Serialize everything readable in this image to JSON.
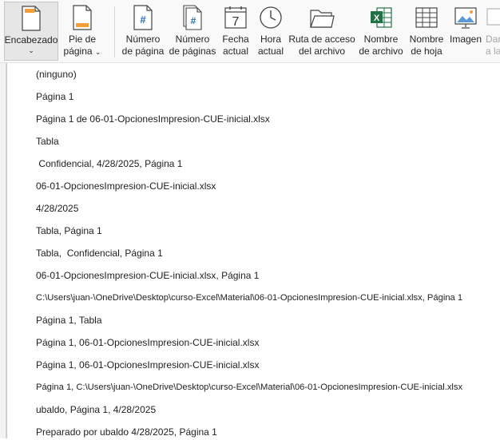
{
  "ribbon": {
    "header": {
      "line1": "Encabezado",
      "icon": "header-page-icon"
    },
    "footer": {
      "line1": "Pie de",
      "line2": "página",
      "icon": "footer-page-icon"
    },
    "page_number": {
      "line1": "Número",
      "line2": "de página",
      "icon": "page-number-icon"
    },
    "page_count": {
      "line1": "Número",
      "line2": "de páginas",
      "icon": "page-count-icon"
    },
    "current_date": {
      "line1": "Fecha",
      "line2": "actual",
      "icon": "calendar-icon",
      "icon_text": "7"
    },
    "current_time": {
      "line1": "Hora",
      "line2": "actual",
      "icon": "clock-icon"
    },
    "file_path": {
      "line1": "Ruta de acceso",
      "line2": "del archivo",
      "icon": "folder-icon"
    },
    "file_name": {
      "line1": "Nombre",
      "line2": "de archivo",
      "icon": "excel-file-icon",
      "icon_text": "X"
    },
    "sheet_name": {
      "line1": "Nombre",
      "line2": "de hoja",
      "icon": "sheet-grid-icon"
    },
    "picture": {
      "line1": "Imagen",
      "icon": "image-icon"
    },
    "format_picture": {
      "line1": "Dar",
      "line2": "a la",
      "icon": "format-image-icon"
    },
    "hash": "#"
  },
  "menu": {
    "items": [
      "(ninguno)",
      "Página 1",
      "Página 1 de 06-01-OpcionesImpresion-CUE-inicial.xlsx",
      "Tabla",
      " Confidencial, 4/28/2025, Página 1",
      "06-01-OpcionesImpresion-CUE-inicial.xlsx",
      "4/28/2025",
      "Tabla, Página 1",
      "Tabla,  Confidencial, Página 1",
      "06-01-OpcionesImpresion-CUE-inicial.xlsx, Página 1",
      "C:\\Users\\juan-\\OneDrive\\Desktop\\curso-Excel\\Material\\06-01-OpcionesImpresion-CUE-inicial.xlsx, Página 1",
      "Página 1, Tabla",
      "Página 1, 06-01-OpcionesImpresion-CUE-inicial.xlsx",
      "Página 1, 06-01-OpcionesImpresion-CUE-inicial.xlsx",
      "Página 1, C:\\Users\\juan-\\OneDrive\\Desktop\\curso-Excel\\Material\\06-01-OpcionesImpresion-CUE-inicial.xlsx",
      "ubaldo, Página 1, 4/28/2025",
      "Preparado por ubaldo 4/28/2025, Página 1"
    ]
  }
}
